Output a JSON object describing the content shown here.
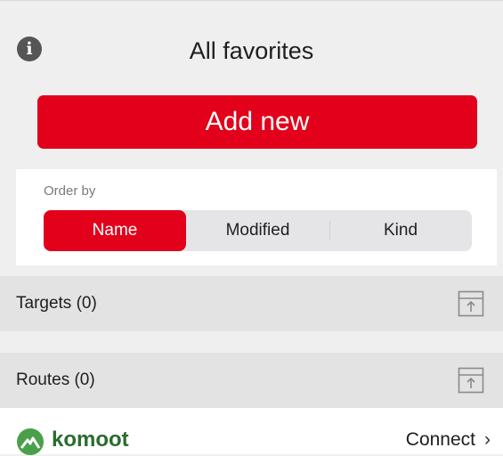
{
  "header": {
    "title": "All favorites",
    "info_icon": "info-icon"
  },
  "add_button": {
    "label": "Add new"
  },
  "order": {
    "label": "Order by",
    "options": [
      "Name",
      "Modified",
      "Kind"
    ],
    "selected": "Name"
  },
  "sections": [
    {
      "label": "Targets (0)",
      "icon": "import-icon"
    },
    {
      "label": "Routes (0)",
      "icon": "import-icon"
    }
  ],
  "footer": {
    "brand": "komoot",
    "connect_label": "Connect",
    "connect_icon": "chevron-right-icon"
  },
  "colors": {
    "accent": "#e2001a",
    "brand_green": "#2b6b2f",
    "background": "#efefef",
    "section_bg": "#e3e3e3"
  }
}
